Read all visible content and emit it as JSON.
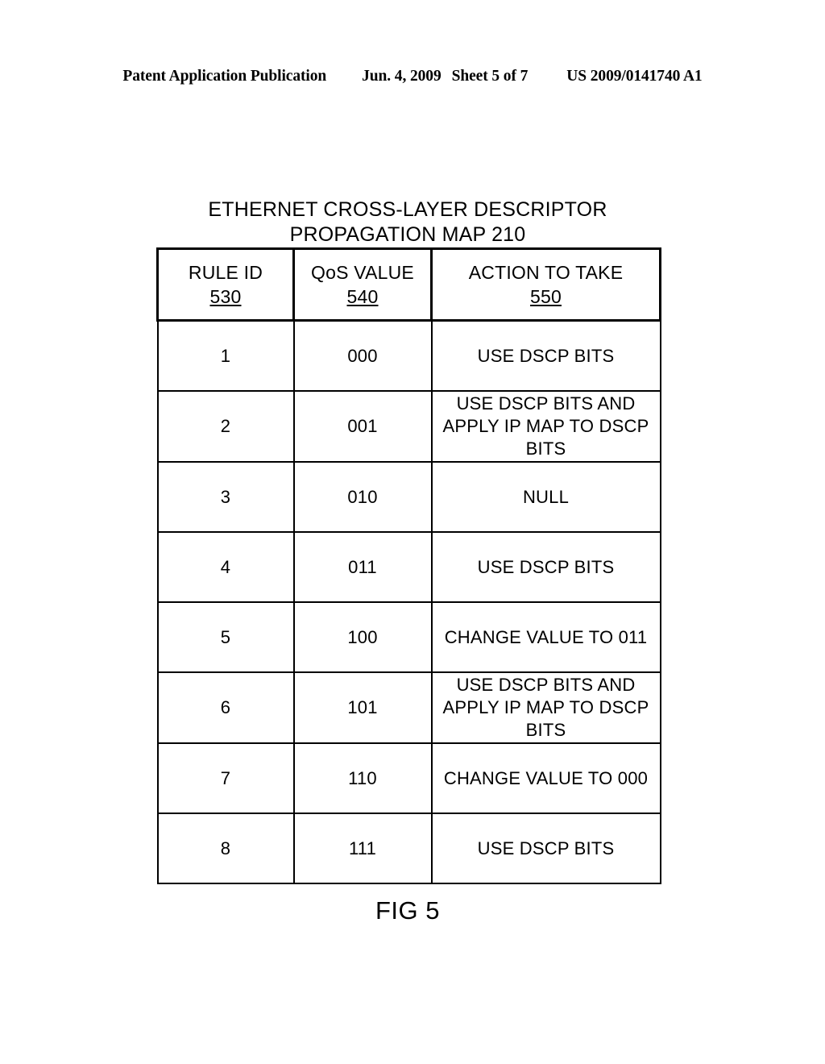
{
  "page": {
    "header": {
      "publication": "Patent Application Publication",
      "date": "Jun. 4, 2009",
      "sheet": "Sheet 5 of 7",
      "patent_number": "US 2009/0141740 A1"
    },
    "figure_title_line1": "ETHERNET CROSS-LAYER DESCRIPTOR",
    "figure_title_line2": "PROPAGATION MAP 210",
    "figure_caption": "FIG 5"
  },
  "table": {
    "columns": [
      {
        "label": "RULE ID",
        "ref": "530"
      },
      {
        "label": "QoS VALUE",
        "ref": "540"
      },
      {
        "label": "ACTION TO TAKE",
        "ref": "550"
      }
    ],
    "rows": [
      {
        "rule_id": "1",
        "qos_value": "000",
        "action_line1": "USE DSCP BITS",
        "action_line2": "",
        "action_line3": ""
      },
      {
        "rule_id": "2",
        "qos_value": "001",
        "action_line1": "USE DSCP BITS AND",
        "action_line2": "APPLY IP MAP TO DSCP",
        "action_line3": "BITS"
      },
      {
        "rule_id": "3",
        "qos_value": "010",
        "action_line1": "NULL",
        "action_line2": "",
        "action_line3": ""
      },
      {
        "rule_id": "4",
        "qos_value": "011",
        "action_line1": "USE DSCP BITS",
        "action_line2": "",
        "action_line3": ""
      },
      {
        "rule_id": "5",
        "qos_value": "100",
        "action_line1": "CHANGE VALUE TO 011",
        "action_line2": "",
        "action_line3": ""
      },
      {
        "rule_id": "6",
        "qos_value": "101",
        "action_line1": "USE DSCP BITS AND",
        "action_line2": "APPLY IP MAP TO DSCP",
        "action_line3": "BITS"
      },
      {
        "rule_id": "7",
        "qos_value": "110",
        "action_line1": "CHANGE VALUE TO 000",
        "action_line2": "",
        "action_line3": ""
      },
      {
        "rule_id": "8",
        "qos_value": "111",
        "action_line1": "USE DSCP BITS",
        "action_line2": "",
        "action_line3": ""
      }
    ]
  }
}
